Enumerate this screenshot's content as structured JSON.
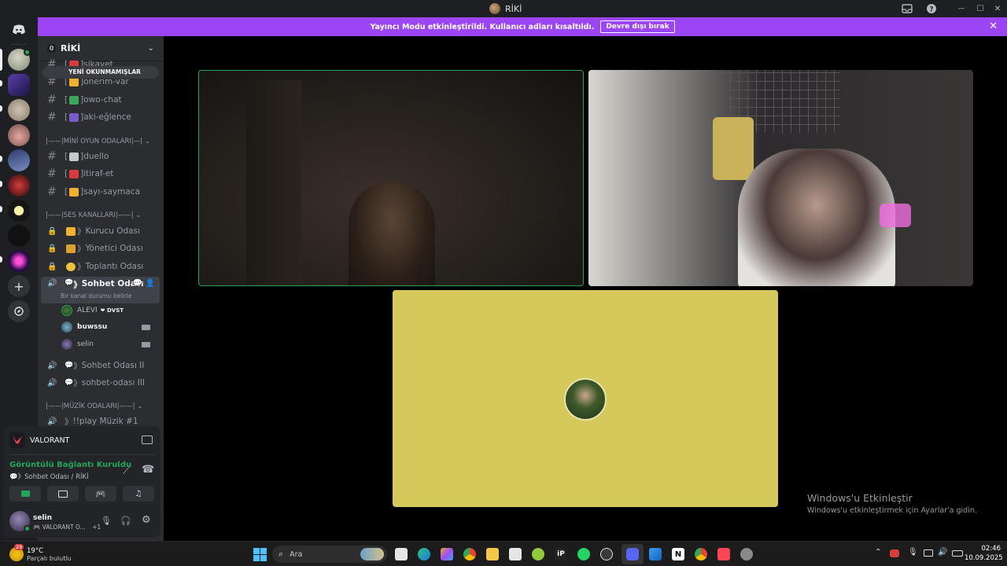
{
  "window": {
    "title": "RİKİ",
    "controls": {
      "inbox_icon": "inbox-icon",
      "help_icon": "help-icon",
      "minimize": "—",
      "maximize": "☐",
      "close": "✕"
    }
  },
  "banner": {
    "message": "Yayıncı Modu etkinleştirildi. Kullanıcı adları kısaltıldı.",
    "button_label": "Devre dışı bırak",
    "close": "✕",
    "color": "#9b45f5"
  },
  "server": {
    "badge": "0",
    "name": "RİKİ",
    "chevron": "⌄"
  },
  "new_unread": "YENİ OKUNMAMIŞLAR",
  "channels": [
    {
      "label": "şikayet"
    },
    {
      "label": "önerim-var"
    },
    {
      "label": "owo-chat"
    },
    {
      "label": "aki-eğlence"
    }
  ],
  "cat_mini": "|MİNİ OYUN ODALARI|",
  "mini_channels": [
    {
      "label": "duello"
    },
    {
      "label": "itiraf-et"
    },
    {
      "label": "sayı-saymaca"
    }
  ],
  "cat_ses": "|SES KANALLARI|",
  "voice_locked": [
    {
      "label": "Kurucu Odası"
    },
    {
      "label": "Yönetici Odası"
    },
    {
      "label": "Toplantı Odası"
    }
  ],
  "active_voice": {
    "label": "Sohbet Odası",
    "status": "Bir kanal durumu belirle"
  },
  "voice_users": [
    {
      "name": "ALEVI",
      "tag": "DVST"
    },
    {
      "name": "buwssu"
    },
    {
      "name": "selin"
    }
  ],
  "voice_other": [
    {
      "label": "Sohbet Odası II"
    },
    {
      "label": "sohbet-odası III"
    }
  ],
  "cat_muzik": "|MÜZİK ODALARI|",
  "muzik_channels": [
    {
      "label": "!!play Müzik #1"
    }
  ],
  "activity": {
    "game": "VALORANT"
  },
  "connection": {
    "status": "Görüntülü Bağlantı Kuruldu",
    "location": "Sohbet Odası / RİKİ"
  },
  "user": {
    "name": "selin",
    "status": "VALORANT O...",
    "extra": "+1"
  },
  "main": {
    "activate_title": "Windows'u Etkinleştir",
    "activate_sub": "Windows'u etkinleştirmek için Ayarlar'a gidin.",
    "speaking_color": "#23a55a",
    "tile3_bg": "#d4c95a"
  },
  "taskbar": {
    "weather_temp": "19°C",
    "weather_desc": "Parçalı bulutlu",
    "weather_badge": "29",
    "search_placeholder": "Ara",
    "time": "02:46",
    "date": "10.09.2025"
  }
}
